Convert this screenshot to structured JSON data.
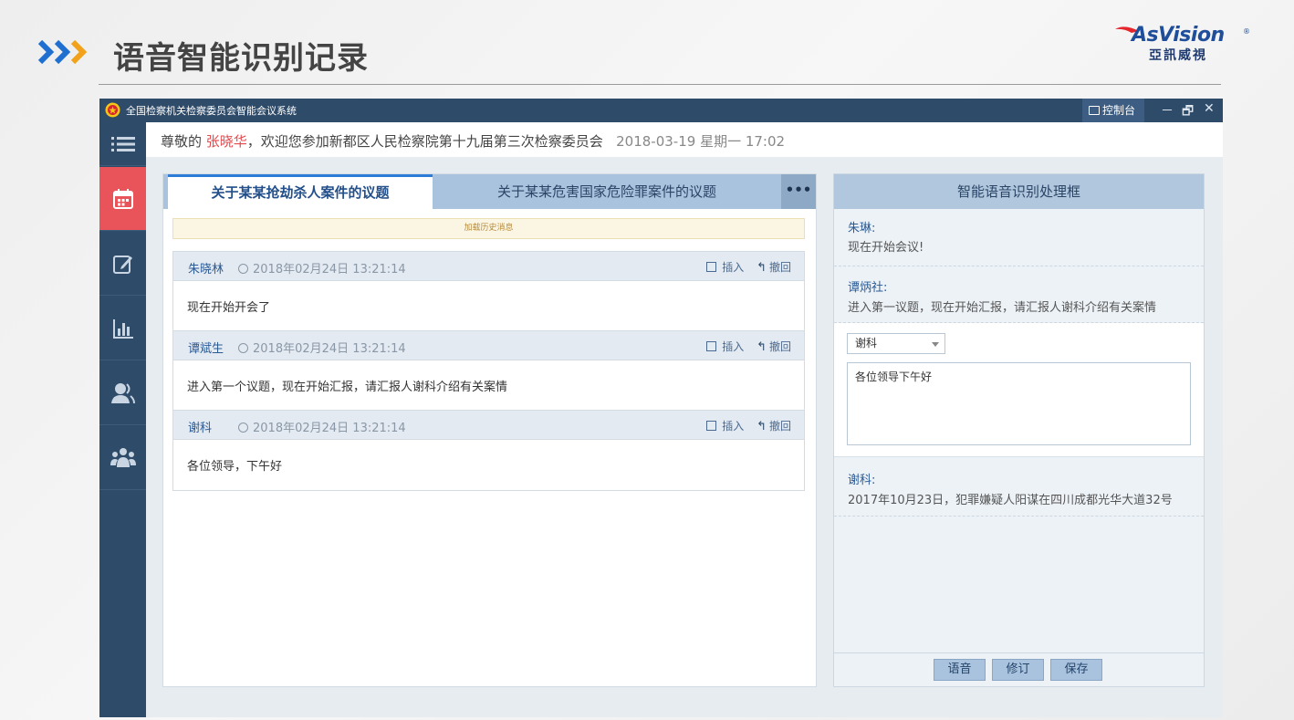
{
  "slide": {
    "title": "语音智能识别记录",
    "logo_en": "AsVision",
    "logo_reg": "®",
    "logo_cn": "亞訊威視",
    "arrow_color": "#1f6fd1",
    "accent_arrow_color": "#f2a21a"
  },
  "window": {
    "title": "全国检察机关检察委员会智能会议系统",
    "control_label": "控制台",
    "minimize": "－",
    "restore": "🗗",
    "close": "✕"
  },
  "sidenav": {
    "items": [
      {
        "icon": "menu-icon",
        "active": false
      },
      {
        "icon": "calendar-icon",
        "active": true
      },
      {
        "icon": "edit-icon",
        "active": false
      },
      {
        "icon": "bar-chart-icon",
        "active": false
      },
      {
        "icon": "user-icon",
        "active": false
      },
      {
        "icon": "group-icon",
        "active": false
      }
    ]
  },
  "infobar": {
    "prefix": "尊敬的 ",
    "user": "张晓华",
    "message": "，欢迎您参加新都区人民检察院第十九届第三次检察委员会",
    "datetime": "2018-03-19  星期一  17:02"
  },
  "meeting": {
    "tabs": [
      {
        "label": "关于某某抢劫杀人案件的议题"
      },
      {
        "label": "关于某某危害国家危险罪案件的议题"
      }
    ],
    "more": "•••",
    "history_label": "加载历史消息",
    "insert_label": "插入",
    "undo_label": "撤回",
    "messages": [
      {
        "speaker": "朱晓林",
        "time": "2018年02月24日  13:21:14",
        "text": "现在开始开会了"
      },
      {
        "speaker": "谭斌生",
        "time": "2018年02月24日  13:21:14",
        "text": "进入第一个议题，现在开始汇报，请汇报人谢科介绍有关案情"
      },
      {
        "speaker": "谢科",
        "time": "2018年02月24日  13:21:14",
        "text": "各位领导，下午好"
      }
    ]
  },
  "speech": {
    "title": "智能语音识别处理框",
    "entries": [
      {
        "speaker": "朱琳:",
        "text": "现在开始会议!"
      },
      {
        "speaker": "谭炳社:",
        "text": "进入第一议题，现在开始汇报，请汇报人谢科介绍有关案情"
      }
    ],
    "editor": {
      "selected_speaker": "谢科",
      "text": "各位领导下午好"
    },
    "after_entry": {
      "speaker": "谢科:",
      "text": "2017年10月23日，犯罪嫌疑人阳谋在四川成都光华大道32号"
    },
    "buttons": {
      "voice": "语音",
      "revise": "修订",
      "save": "保存"
    }
  }
}
